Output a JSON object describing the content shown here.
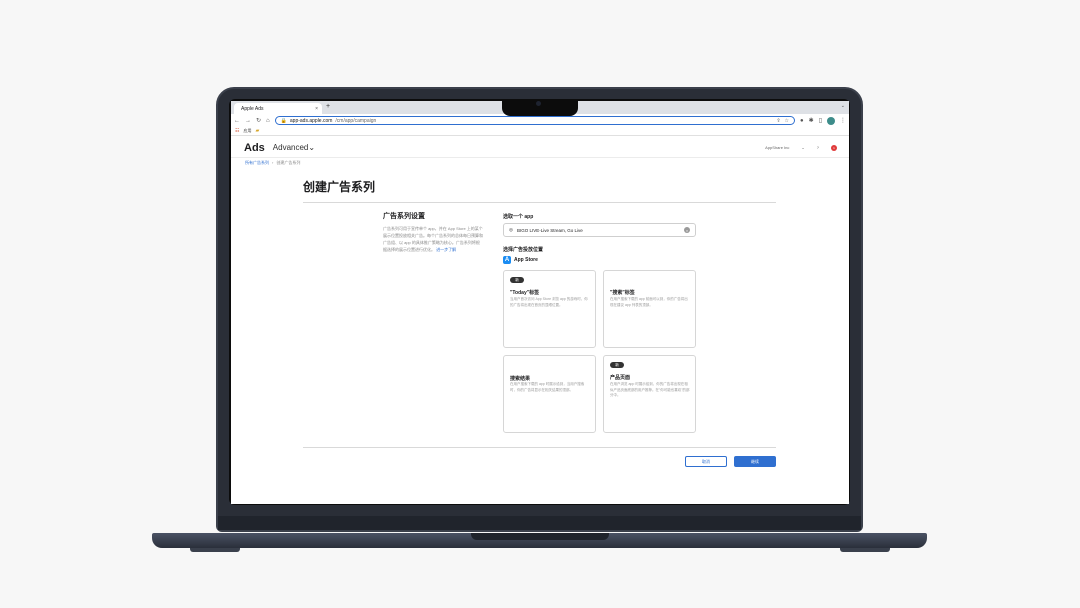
{
  "browser": {
    "tab_title": "Apple Ads",
    "tab_close": "×",
    "new_tab": "+",
    "address_host": "app-ads.apple.com",
    "address_path": "/cm/app/campaign",
    "bookmark_label": "应用"
  },
  "header": {
    "logo": "Ads",
    "product": "Advanced",
    "org": "AppShare Inc",
    "badge": "1"
  },
  "breadcrumb": {
    "root": "所有广告系列",
    "separator": "›",
    "current": "创建广告系列"
  },
  "page": {
    "title": "创建广告系列"
  },
  "settings": {
    "title": "广告系列设置",
    "desc": "广告系列可用于宣传单个 app，并在 App Store 上的某个展示位置投放相关广告。每个广告系列的总体每日预算和广告组、以 app 的具体推广策略为核心。广告系列将根据选择的展示位置进行优化。",
    "more": "进一步了解"
  },
  "app_select": {
    "label": "选取一个 app",
    "value": "BIGO LIVE-Live Stream, Go Live"
  },
  "placement": {
    "label": "选择广告投放位置",
    "store": "App Store"
  },
  "cards": [
    {
      "badge": "新",
      "title": "\"Today\"标签",
      "desc": "当用户首次访问 App Store 浏览 app 的游戏时，你的广告将出现在首页的显眼位置。"
    },
    {
      "badge": "",
      "title": "\"搜索\"标签",
      "desc": "在用户搜索下载的 app 前面可以到，你的广告将出现在建议 app 列表的顶部。"
    },
    {
      "badge": "",
      "title": "搜索结果",
      "desc": "在用户搜索下载的 app 时展示给到，当用户搜索时，你的广告将显示在相关结果的顶部。"
    },
    {
      "badge": "新",
      "title": "产品页面",
      "desc": "在用户浏览 app 时展示给到，你的广告将出现在相似产品页面底部的用户推荐。在\"你可能也喜欢\"的部分中。"
    }
  ],
  "actions": {
    "cancel": "取消",
    "next": "继续"
  },
  "colors": {
    "accent": "#2f6fd0",
    "laptop": "#2a2e37"
  }
}
